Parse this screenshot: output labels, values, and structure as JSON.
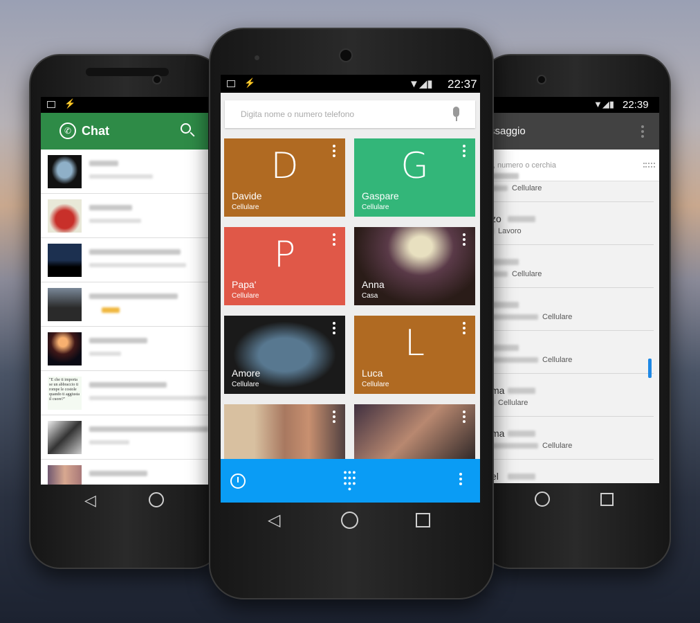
{
  "left_phone": {
    "app_title": "Chat",
    "icons": [
      "whatsapp-logo",
      "search-icon"
    ],
    "header_color": "#2e8b47",
    "chat_thumb_quote": "\"E che ti importa se un abbraccio ti rompe le costole quando ti aggiusta il cuore?\""
  },
  "center_phone": {
    "status_time": "22:37",
    "search_placeholder": "Digita nome o numero telefono",
    "accent_color": "#0a9cf5",
    "favorites": [
      {
        "letter": "D",
        "name": "Davide",
        "type": "Cellulare",
        "color": "#b06a22"
      },
      {
        "letter": "G",
        "name": "Gaspare",
        "type": "Cellulare",
        "color": "#33b679"
      },
      {
        "letter": "P",
        "name": "Papa'",
        "type": "Cellulare",
        "color": "#e05848"
      },
      {
        "letter": "",
        "name": "Anna",
        "type": "Casa",
        "color": "#3a2a28"
      },
      {
        "letter": "",
        "name": "Amore",
        "type": "Cellulare",
        "color": "#2d3a44"
      },
      {
        "letter": "L",
        "name": "Luca",
        "type": "Cellulare",
        "color": "#b06a22"
      }
    ]
  },
  "right_phone": {
    "status_time": "22:39",
    "title_partial": "ssaggio",
    "search_placeholder_partial": "il, numero o cerchia",
    "contacts": [
      {
        "name": "",
        "type": "Cellulare"
      },
      {
        "name": "zo",
        "type": "Lavoro"
      },
      {
        "name": "",
        "type": "Cellulare"
      },
      {
        "name": "",
        "type": "Cellulare"
      },
      {
        "name": "",
        "type": "Cellulare"
      },
      {
        "name": "ma",
        "type": "Cellulare"
      },
      {
        "name": "ma",
        "type": "Cellulare"
      },
      {
        "name": "el",
        "type": ""
      }
    ]
  }
}
